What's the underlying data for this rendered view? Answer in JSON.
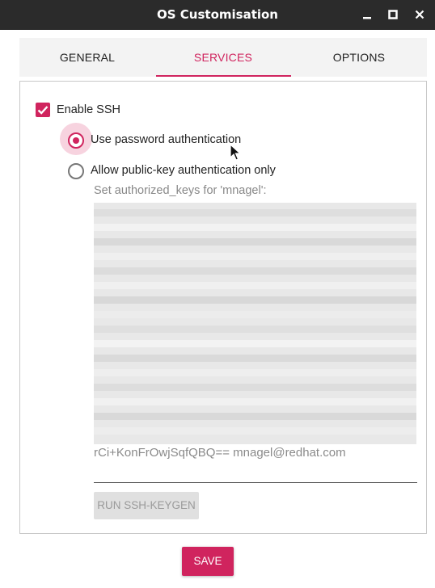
{
  "window": {
    "title": "OS Customisation"
  },
  "tabs": [
    {
      "label": "GENERAL",
      "active": false
    },
    {
      "label": "SERVICES",
      "active": true
    },
    {
      "label": "OPTIONS",
      "active": false
    }
  ],
  "ssh": {
    "enable_label": "Enable SSH",
    "enabled": true,
    "auth_options": [
      {
        "label": "Use password authentication",
        "selected": true
      },
      {
        "label": "Allow public-key authentication only",
        "selected": false
      }
    ],
    "keys_label": "Set authorized_keys for 'mnagel':",
    "keys_value_tail": "rCi+KonFrOwjSqfQBQ== mnagel@redhat.com",
    "keygen_button": "RUN SSH-KEYGEN"
  },
  "footer": {
    "save_label": "SAVE"
  },
  "colors": {
    "accent": "#d0245e",
    "titlebar": "#2b2b2b",
    "tab_bg": "#f3f3f3"
  }
}
